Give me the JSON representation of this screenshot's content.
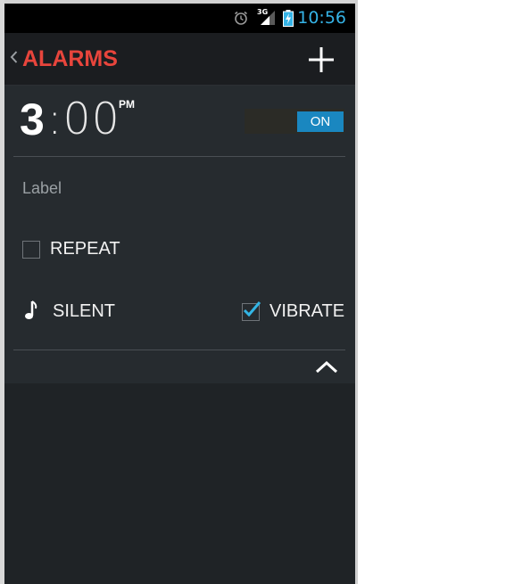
{
  "status_bar": {
    "time": "10:56",
    "network_type": "3G",
    "icons": [
      "alarm-clock-icon",
      "signal-icon",
      "battery-charging-icon"
    ]
  },
  "action_bar": {
    "title": "ALARMS",
    "back_icon": "chevron-left-icon",
    "add_icon": "plus-icon"
  },
  "alarm": {
    "hour": "3",
    "minutes": ":00",
    "ampm": "PM",
    "toggle_state": "ON",
    "label_placeholder": "Label",
    "repeat_label": "REPEAT",
    "repeat_checked": false,
    "ringtone_label": "SILENT",
    "ringtone_icon": "music-note-icon",
    "vibrate_label": "VIBRATE",
    "vibrate_checked": true,
    "collapse_icon": "chevron-up-icon"
  },
  "colors": {
    "accent_red": "#e8453c",
    "accent_blue": "#1a87c0",
    "status_time_blue": "#35b3e6",
    "background": "#1f2225"
  }
}
